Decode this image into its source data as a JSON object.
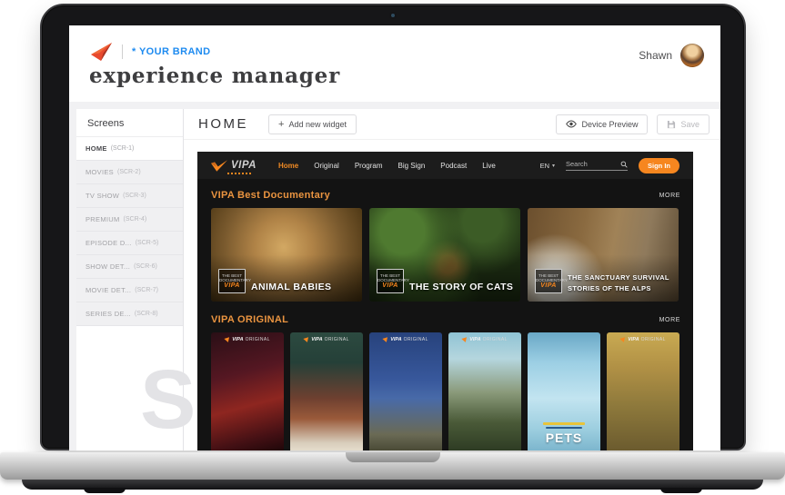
{
  "header": {
    "brand": "* YOUR BRAND",
    "title": "experience manager",
    "user": "Shawn"
  },
  "sidebar": {
    "title": "Screens",
    "items": [
      {
        "label": "HOME",
        "code": "(SCR-1)",
        "active": true
      },
      {
        "label": "MOVIES",
        "code": "(SCR-2)",
        "active": false
      },
      {
        "label": "TV SHOW",
        "code": "(SCR-3)",
        "active": false
      },
      {
        "label": "PREMIUM",
        "code": "(SCR-4)",
        "active": false
      },
      {
        "label": "EPISODE D...",
        "code": "(SCR-5)",
        "active": false
      },
      {
        "label": "SHOW DET...",
        "code": "(SCR-6)",
        "active": false
      },
      {
        "label": "MOVIE DET...",
        "code": "(SCR-7)",
        "active": false
      },
      {
        "label": "SERIES DE...",
        "code": "(SCR-8)",
        "active": false
      }
    ]
  },
  "toolbar": {
    "screen_title": "HOME",
    "add_widget": "Add new widget",
    "device_preview": "Device Preview",
    "save": "Save"
  },
  "watermark": "Sc",
  "site": {
    "nav": {
      "brand": "VIPA",
      "links": [
        "Home",
        "Original",
        "Program",
        "Big Sign",
        "Podcast",
        "Live"
      ],
      "active_link": "Home",
      "language": "EN",
      "search_placeholder": "Search",
      "sign_in": "Sign In"
    },
    "doc_badge": {
      "top": "THE BEST DOCUMENTARY",
      "brand": "VIPA"
    },
    "poster_badge": {
      "brand": "VIPA",
      "label": "ORIGINAL"
    },
    "sections": [
      {
        "title": "VIPA Best Documentary",
        "more": "MORE",
        "cards": [
          {
            "title": "ANIMAL BABIES",
            "image": "lion-cub-closeup"
          },
          {
            "title": "THE STORY OF CATS",
            "image": "leopard-in-foliage"
          },
          {
            "title": "THE SANCTUARY SURVIVAL STORIES OF THE ALPS",
            "image": "wolf-in-alps"
          }
        ]
      },
      {
        "title": "VIPA ORIGINAL",
        "more": "MORE",
        "posters": [
          {
            "image": "red-action-drama"
          },
          {
            "image": "two-men-food-show"
          },
          {
            "image": "girl-trio-blue"
          },
          {
            "image": "city-recycle-trio"
          },
          {
            "image": "pets-spaceship",
            "title": "PETS"
          },
          {
            "image": "bicycle-ride"
          }
        ]
      }
    ]
  },
  "colors": {
    "accent_orange": "#f6861f",
    "brand_blue": "#1e8bf0",
    "panel_dark": "#131313",
    "section_title_orange": "#ea9440"
  }
}
